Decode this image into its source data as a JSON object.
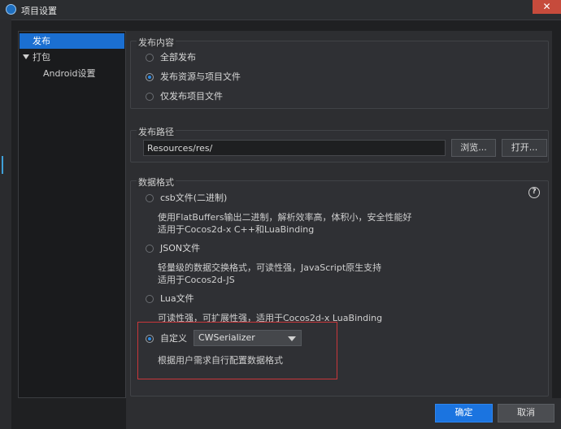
{
  "window": {
    "title": "项目设置",
    "close_label": "✕"
  },
  "sidebar": {
    "items": [
      {
        "label": "发布",
        "selected": true
      },
      {
        "label": "打包",
        "selected": false,
        "expanded": true
      },
      {
        "label": "Android设置",
        "selected": false
      }
    ]
  },
  "publish_content": {
    "title": "发布内容",
    "options": [
      {
        "label": "全部发布",
        "selected": false
      },
      {
        "label": "发布资源与项目文件",
        "selected": true
      },
      {
        "label": "仅发布项目文件",
        "selected": false
      }
    ]
  },
  "publish_path": {
    "title": "发布路径",
    "value": "Resources/res/",
    "browse_label": "浏览...",
    "open_label": "打开..."
  },
  "data_format": {
    "title": "数据格式",
    "help_label": "?",
    "options": [
      {
        "label": "csb文件(二进制)",
        "selected": false,
        "desc1": "使用FlatBuffers输出二进制，解析效率高，体积小，安全性能好",
        "desc2": "适用于Cocos2d-x C++和LuaBinding"
      },
      {
        "label": "JSON文件",
        "selected": false,
        "desc1": "轻量级的数据交换格式，可读性强，JavaScript原生支持",
        "desc2": "适用于Cocos2d-JS"
      },
      {
        "label": "Lua文件",
        "selected": false,
        "desc1": "可读性强，可扩展性强，适用于Cocos2d-x LuaBinding"
      },
      {
        "label": "自定义",
        "selected": true,
        "select_value": "CWSerializer",
        "desc1": "根据用户需求自行配置数据格式"
      }
    ]
  },
  "footer": {
    "ok_label": "确定",
    "cancel_label": "取消"
  },
  "colors": {
    "accent": "#1b74e0",
    "selection": "#1b6fd1",
    "highlight_border": "#c9363a"
  }
}
